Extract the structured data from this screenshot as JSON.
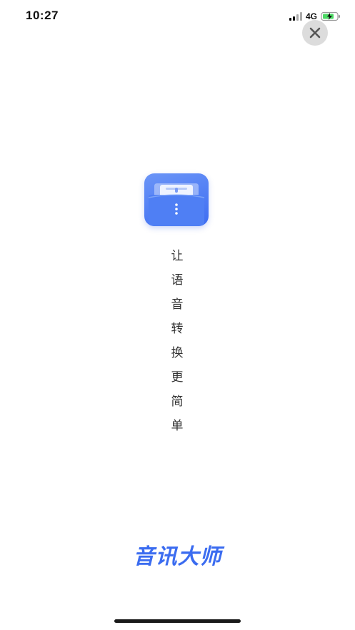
{
  "status_bar": {
    "time": "10:27",
    "network": "4G",
    "icons": [
      "signal-icon",
      "battery-charging-icon"
    ]
  },
  "close_button": {
    "label": "×",
    "icon": "close-icon"
  },
  "app_logo": {
    "icon": "app-logo-icon",
    "color": "#4a78f3"
  },
  "slogan": {
    "chars": [
      "让",
      "语",
      "音",
      "转",
      "换",
      "更",
      "简",
      "单"
    ]
  },
  "brand": {
    "name": "音讯大师",
    "color": "#3b6cf0"
  }
}
